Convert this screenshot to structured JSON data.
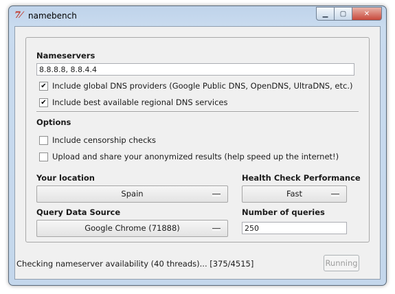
{
  "window": {
    "title": "namebench",
    "app_icon": "namebench-logo",
    "caption_buttons": {
      "minimize": "minimize-icon",
      "maximize": "maximize-icon",
      "close": "close-icon"
    }
  },
  "nameservers": {
    "label": "Nameservers",
    "value": "8.8.8.8, 8.8.4.4",
    "checkboxes": [
      {
        "label": "Include global DNS providers (Google Public DNS, OpenDNS, UltraDNS, etc.)",
        "checked": true
      },
      {
        "label": "Include best available regional DNS services",
        "checked": true
      }
    ]
  },
  "options": {
    "label": "Options",
    "checkboxes": [
      {
        "label": "Include censorship checks",
        "checked": false
      },
      {
        "label": "Upload and share your anonymized results (help speed up the internet!)",
        "checked": false
      }
    ]
  },
  "location": {
    "label": "Your location",
    "value": "Spain"
  },
  "health_check": {
    "label": "Health Check Performance",
    "value": "Fast"
  },
  "data_source": {
    "label": "Query Data Source",
    "value": "Google Chrome (71888)"
  },
  "queries": {
    "label": "Number of queries",
    "value": "250"
  },
  "status": {
    "text": "Checking nameserver availability (40 threads)... [375/4515]"
  },
  "run_button": {
    "label": "Running",
    "enabled": false
  }
}
